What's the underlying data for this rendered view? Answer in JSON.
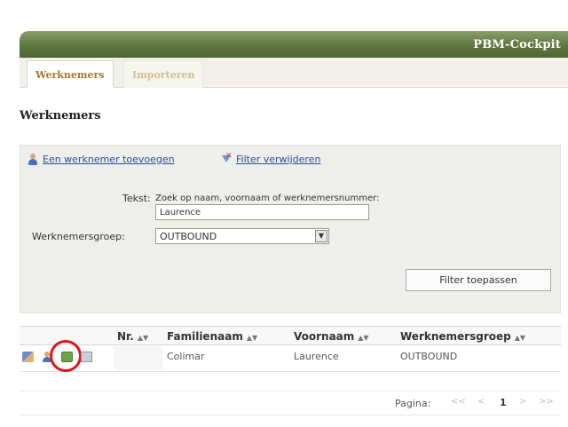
{
  "app": {
    "title": "PBM-Cockpit"
  },
  "tabs": [
    {
      "label": "Werknemers"
    },
    {
      "label": "Importeren"
    }
  ],
  "page": {
    "heading": "Werknemers"
  },
  "filter": {
    "add_link": "Een werknemer toevoegen",
    "remove_filter_link": "Filter verwijderen",
    "tekst_label": "Tekst:",
    "hint": "Zoek op naam, voornaam of werknemersnummer:",
    "tekst_value": "Laurence",
    "groep_label": "Werknemersgroep:",
    "groep_value": "OUTBOUND",
    "apply_button": "Filter toepassen"
  },
  "table": {
    "sort_glyph": "▲▼",
    "columns": [
      "Nr.",
      "Familienaam",
      "Voornaam",
      "Werknemersgroep"
    ],
    "rows": [
      {
        "nr": "",
        "familienaam": "Colimar",
        "voornaam": "Laurence",
        "groep": "OUTBOUND"
      }
    ]
  },
  "pager": {
    "label": "Pagina:",
    "first": "<<",
    "prev": "<",
    "current": "1",
    "next": ">",
    "last": ">>"
  },
  "colors": {
    "header_green": "#5f7640",
    "tab_active_text": "#a07a2a",
    "link_blue": "#2a4fa0",
    "highlight_red": "#e0141e"
  }
}
